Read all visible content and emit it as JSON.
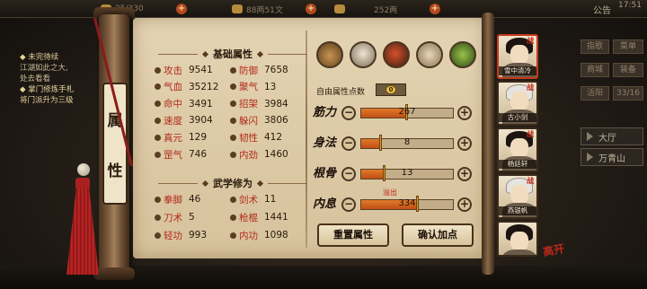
{
  "topbar": {
    "resources": [
      {
        "text": "25/330",
        "icon": "stamina-icon"
      },
      {
        "text": "88两51文",
        "icon": "coin-icon"
      },
      {
        "text": "252两",
        "icon": "ingot-icon"
      }
    ],
    "notice": "公告",
    "clock": "17:51"
  },
  "quest_log": {
    "title": "◆ 未完待续",
    "line1": "江湖如此之大,",
    "line2": "处去看看",
    "title2": "◆ 掌门修炼手札",
    "line3": "将门派升为三级"
  },
  "right_menu": {
    "btn1": "指歌",
    "btn2": "菜单",
    "btn3": "商城",
    "btn4": "装备",
    "btn5": "活阳",
    "btn6": "33/16",
    "btn7": "大厅",
    "loc1": "大厅",
    "loc2": "万青山"
  },
  "tab": {
    "char1": "属",
    "char2": "性"
  },
  "basic_attrs": {
    "title": "基础属性",
    "rows": [
      {
        "name": "攻击",
        "value": "9541"
      },
      {
        "name": "防御",
        "value": "7658"
      },
      {
        "name": "气血",
        "value": "35212"
      },
      {
        "name": "聚气",
        "value": "13"
      },
      {
        "name": "命中",
        "value": "3491"
      },
      {
        "name": "招架",
        "value": "3984"
      },
      {
        "name": "速度",
        "value": "3904"
      },
      {
        "name": "躲闪",
        "value": "3806"
      },
      {
        "name": "真元",
        "value": "129"
      },
      {
        "name": "韧性",
        "value": "412"
      },
      {
        "name": "罡气",
        "value": "746"
      },
      {
        "name": "内劲",
        "value": "1460"
      }
    ]
  },
  "martial_attrs": {
    "title": "武学修为",
    "rows": [
      {
        "name": "拳脚",
        "value": "46"
      },
      {
        "name": "剑术",
        "value": "11"
      },
      {
        "name": "刀术",
        "value": "5"
      },
      {
        "name": "枪棍",
        "value": "1441"
      },
      {
        "name": "轻功",
        "value": "993"
      },
      {
        "name": "内功",
        "value": "1098"
      }
    ]
  },
  "skill_icons": [
    "hat-icon",
    "sect-badge-icon",
    "eye-shield-icon",
    "arm-icon",
    "jade-icon"
  ],
  "free_points": {
    "label": "自由属性点数",
    "value": "0"
  },
  "stats": [
    {
      "label": "筋力",
      "value": "267",
      "fill": 0.5
    },
    {
      "label": "身法",
      "value": "8",
      "fill": 0.22
    },
    {
      "label": "根骨",
      "value": "13",
      "fill": 0.25
    },
    {
      "label": "内息",
      "value": "334",
      "fill": 0.62
    }
  ],
  "overflow_tag": "溢出",
  "buttons": {
    "reset": "重置属性",
    "confirm": "确认加点"
  },
  "characters": [
    {
      "name": "雪中清冷",
      "hair": "dark",
      "selected": true
    },
    {
      "name": "古小剑",
      "hair": "white",
      "selected": false
    },
    {
      "name": "杨廷轩",
      "hair": "dark",
      "selected": false
    },
    {
      "name": "燕银帆",
      "hair": "white",
      "selected": false
    },
    {
      "name": "",
      "hair": "dark",
      "selected": false
    }
  ],
  "char_tag": "战",
  "pager": "高开"
}
